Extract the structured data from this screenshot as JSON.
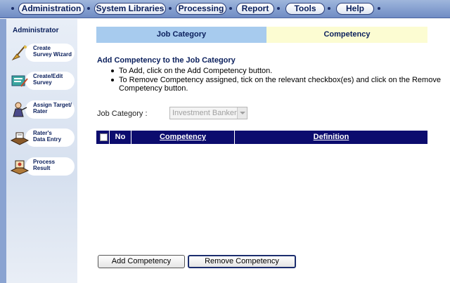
{
  "nav": {
    "tabs": [
      {
        "label": "Administration"
      },
      {
        "label": "System Libraries"
      },
      {
        "label": "Processing"
      },
      {
        "label": "Report"
      },
      {
        "label": "Tools"
      },
      {
        "label": "Help"
      }
    ]
  },
  "sidebar": {
    "title": "Administrator",
    "items": [
      {
        "label_line1": "Create",
        "label_line2": "Survey Wizard",
        "icon": "wizard-broom-icon"
      },
      {
        "label_line1": "Create/Edit",
        "label_line2": "Survey",
        "icon": "edit-survey-icon"
      },
      {
        "label_line1": "Assign Target/",
        "label_line2": "Rater",
        "icon": "assign-target-icon"
      },
      {
        "label_line1": "Rater's",
        "label_line2": "Data Entry",
        "icon": "data-entry-icon"
      },
      {
        "label_line1": "Process",
        "label_line2": "Result",
        "icon": "process-result-icon"
      }
    ]
  },
  "main": {
    "tab_job": "Job Category",
    "tab_competency": "Competency",
    "heading": "Add Competency to the Job Category",
    "instructions": [
      "To Add, click on the Add Competency button.",
      "To Remove Competency assigned, tick on the relevant checkbox(es) and click on the Remove",
      "Competency button."
    ],
    "job_category_label": "Job Category :",
    "job_category_value": "Investment Banker",
    "table_headers": {
      "no": "No",
      "competency": "Competency",
      "definition": "Definition"
    },
    "add_button": "Add Competency",
    "remove_button": "Remove Competency"
  },
  "colors": {
    "nav_bg": "#7f9bcd",
    "tab_job_bg": "#a7cbee",
    "tab_competency_bg": "#fcfcd2",
    "table_header_bg": "#0c0c6e",
    "heading_text": "#0a1f5c"
  }
}
